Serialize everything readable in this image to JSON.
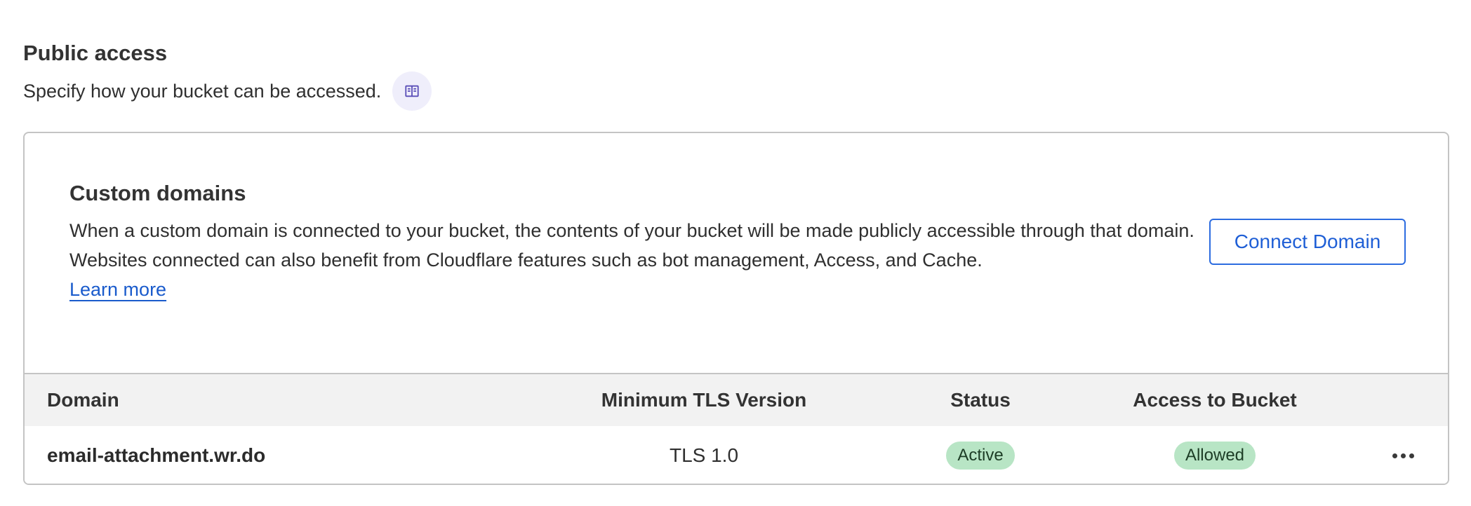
{
  "public_access": {
    "title": "Public access",
    "description": "Specify how your bucket can be accessed.",
    "docs_icon": "book-open-icon"
  },
  "custom_domains": {
    "title": "Custom domains",
    "description": "When a custom domain is connected to your bucket, the contents of your bucket will be made publicly accessible through that domain. Websites connected can also benefit from Cloudflare features such as bot management, Access, and Cache.",
    "learn_more": "Learn more",
    "connect_button": "Connect Domain",
    "table": {
      "headers": {
        "domain": "Domain",
        "min_tls": "Minimum TLS Version",
        "status": "Status",
        "access": "Access to Bucket"
      },
      "rows": [
        {
          "domain": "email-attachment.wr.do",
          "min_tls": "TLS 1.0",
          "status": "Active",
          "access": "Allowed",
          "actions_icon": "ellipsis-icon"
        }
      ]
    }
  },
  "colors": {
    "accent": "#2c6ce0",
    "badge_green": "#b8e5c5",
    "header_bg": "#f2f2f2",
    "icon_circle": "#efeefb"
  }
}
